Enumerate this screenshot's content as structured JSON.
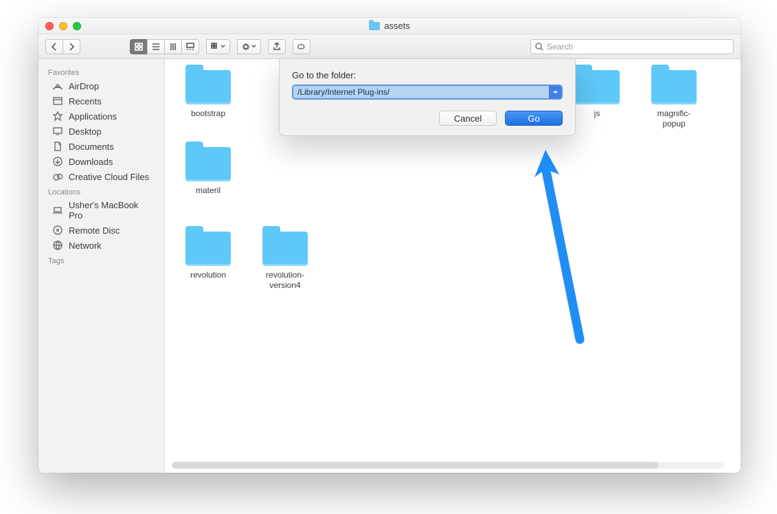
{
  "window": {
    "title": "assets"
  },
  "toolbar": {
    "search_placeholder": "Search"
  },
  "sidebar": {
    "favorites_header": "Favorites",
    "favorites": [
      {
        "label": "AirDrop",
        "icon": "airdrop"
      },
      {
        "label": "Recents",
        "icon": "recents"
      },
      {
        "label": "Applications",
        "icon": "applications"
      },
      {
        "label": "Desktop",
        "icon": "desktop"
      },
      {
        "label": "Documents",
        "icon": "documents"
      },
      {
        "label": "Downloads",
        "icon": "downloads"
      },
      {
        "label": "Creative Cloud Files",
        "icon": "creative-cloud"
      }
    ],
    "locations_header": "Locations",
    "locations": [
      {
        "label": "Usher's MacBook Pro",
        "icon": "laptop"
      },
      {
        "label": "Remote Disc",
        "icon": "disc"
      },
      {
        "label": "Network",
        "icon": "network"
      }
    ],
    "tags_header": "Tags"
  },
  "files": {
    "row1": [
      {
        "label": "bootstrap"
      },
      {
        "label": "js"
      },
      {
        "label": "magnific-popup"
      },
      {
        "label": "materil"
      }
    ],
    "row2": [
      {
        "label": "revolution"
      },
      {
        "label": "revolution-version4"
      }
    ]
  },
  "dialog": {
    "label": "Go to the folder:",
    "value": "/Library/Internet Plug-ins/",
    "cancel": "Cancel",
    "go": "Go"
  }
}
